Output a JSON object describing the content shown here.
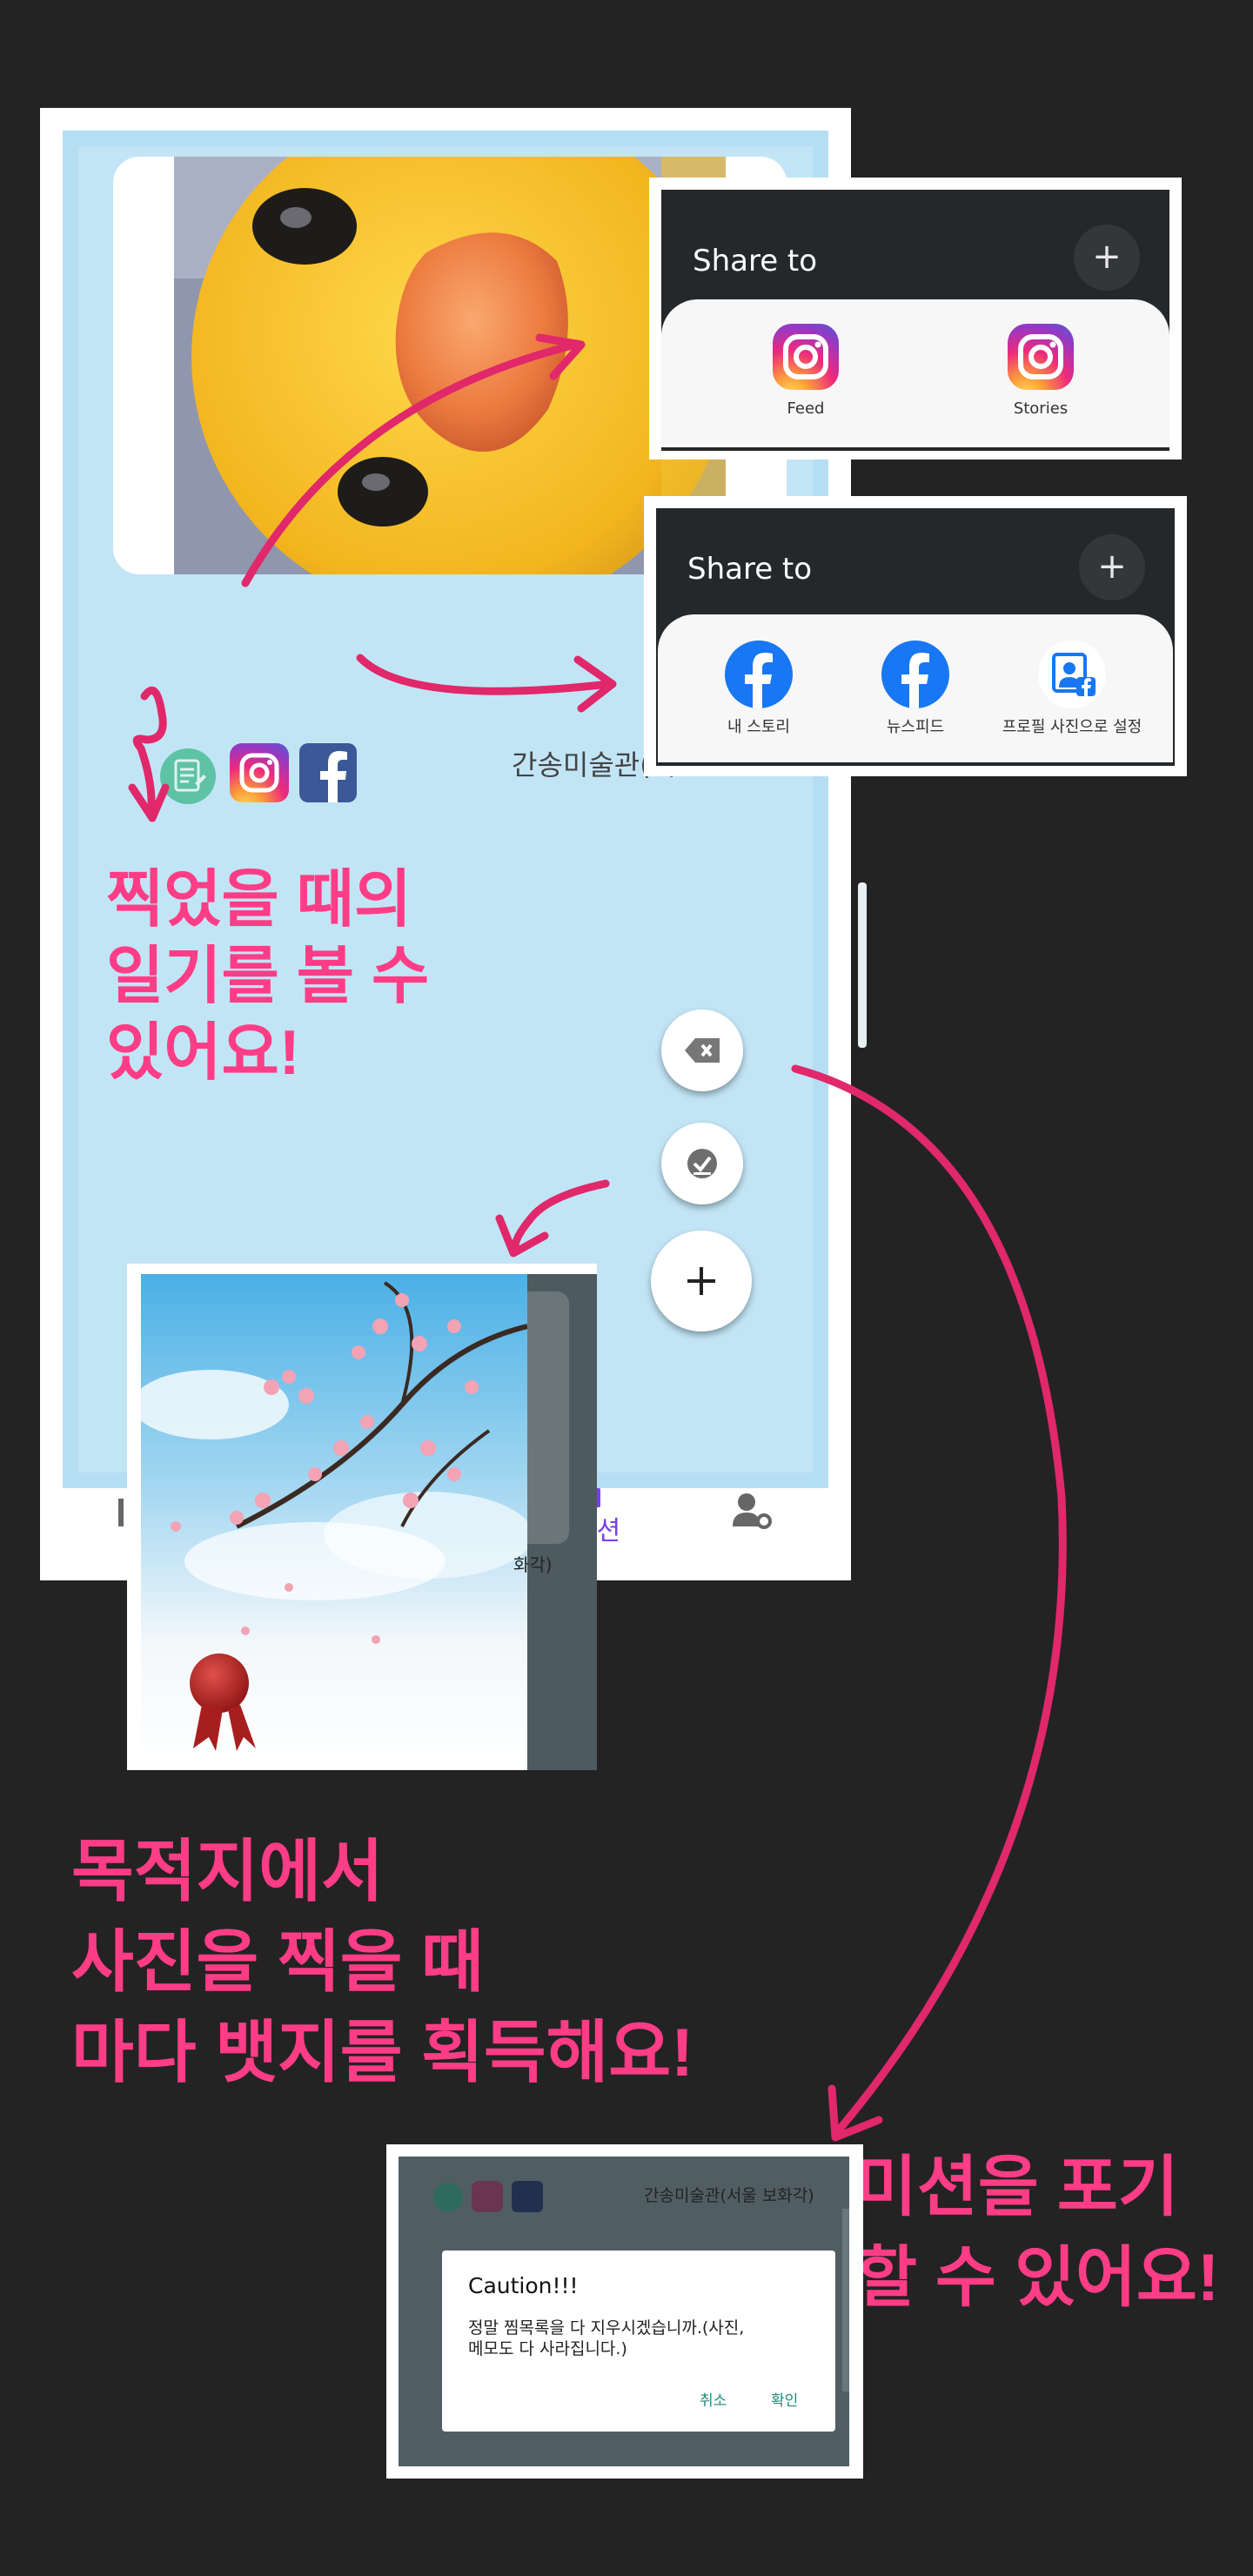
{
  "main_screen": {
    "place_name": "간송미술관(서",
    "bottom_nav": {
      "active_label": "미션",
      "caption_partial": "화각)"
    }
  },
  "share_sheet_instagram": {
    "title": "Share to",
    "options": [
      {
        "label": "Feed"
      },
      {
        "label": "Stories"
      }
    ]
  },
  "share_sheet_facebook": {
    "title": "Share to",
    "options": [
      {
        "label": "내 스토리"
      },
      {
        "label": "뉴스피드"
      },
      {
        "label": "프로필 사진으로 설정"
      }
    ]
  },
  "annotations": {
    "diary": [
      "찍었을 때의",
      "일기를 볼 수",
      "있어요!"
    ],
    "badge": [
      "목적지에서",
      "사진을 찍을 때",
      "마다 뱃지를 획득해요!"
    ],
    "give_up": [
      "미션을 포기",
      "할 수 있어요!"
    ]
  },
  "caution_dialog": {
    "header_place": "간송미술관(서울 보화각)",
    "title": "Caution!!!",
    "message_line1": "정말 찜목록을 다 지우시겠습니까.(사진,",
    "message_line2": "메모도 다 사라집니다.)",
    "cancel_label": "취소",
    "confirm_label": "확인"
  },
  "colors": {
    "background": "#232323",
    "accent_pink": "#ff3d86",
    "arrow_pink": "#e0286b",
    "screen_blue": "#c2e5f6",
    "nav_purple": "#7b3fe4",
    "dialog_button_teal": "#1a8f7a"
  },
  "icons": [
    "diary-icon",
    "instagram-icon",
    "facebook-icon",
    "delete-icon",
    "check-icon",
    "plus-icon",
    "profile-settings-icon",
    "mission-icon",
    "wax-seal-badge"
  ]
}
